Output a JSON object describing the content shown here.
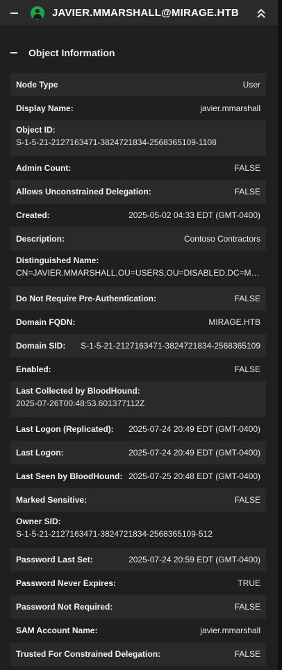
{
  "header": {
    "title": "JAVIER.MMARSHALL@MIRAGE.HTB",
    "collapse_icon": "minus-icon",
    "user_icon": "user-icon",
    "expand_icon": "double-chevron-up-icon",
    "user_icon_color": "#22a34a"
  },
  "section": {
    "title": "Object Information",
    "collapse_icon": "minus-icon"
  },
  "properties": [
    {
      "label": "Node Type",
      "value": "User"
    },
    {
      "label": "Display Name:",
      "value": "javier.mmarshall"
    },
    {
      "label": "Object ID:",
      "value": "S-1-5-21-2127163471-3824721834-2568365109-1108"
    },
    {
      "label": "Admin Count:",
      "value": "FALSE"
    },
    {
      "label": "Allows Unconstrained Delegation:",
      "value": "FALSE"
    },
    {
      "label": "Created:",
      "value": "2025-05-02 04:33 EDT (GMT-0400)"
    },
    {
      "label": "Description:",
      "value": "Contoso Contractors"
    },
    {
      "label": "Distinguished Name:",
      "value": "CN=JAVIER.MMARSHALL,OU=USERS,OU=DISABLED,DC=MIRA..."
    },
    {
      "label": "Do Not Require Pre-Authentication:",
      "value": "FALSE"
    },
    {
      "label": "Domain FQDN:",
      "value": "MIRAGE.HTB"
    },
    {
      "label": "Domain SID:",
      "value": "S-1-5-21-2127163471-3824721834-2568365109"
    },
    {
      "label": "Enabled:",
      "value": "FALSE"
    },
    {
      "label": "Last Collected by BloodHound:",
      "value": "2025-07-26T00:48:53.601377112Z"
    },
    {
      "label": "Last Logon (Replicated):",
      "value": "2025-07-24 20:49 EDT (GMT-0400)"
    },
    {
      "label": "Last Logon:",
      "value": "2025-07-24 20:49 EDT (GMT-0400)"
    },
    {
      "label": "Last Seen by BloodHound:",
      "value": "2025-07-25 20:48 EDT (GMT-0400)"
    },
    {
      "label": "Marked Sensitive:",
      "value": "FALSE"
    },
    {
      "label": "Owner SID:",
      "value": "S-1-5-21-2127163471-3824721834-2568365109-512"
    },
    {
      "label": "Password Last Set:",
      "value": "2025-07-24 20:59 EDT (GMT-0400)"
    },
    {
      "label": "Password Never Expires:",
      "value": "TRUE"
    },
    {
      "label": "Password Not Required:",
      "value": "FALSE"
    },
    {
      "label": "SAM Account Name:",
      "value": "javier.mmarshall"
    },
    {
      "label": "Trusted For Constrained Delegation:",
      "value": "FALSE"
    }
  ]
}
